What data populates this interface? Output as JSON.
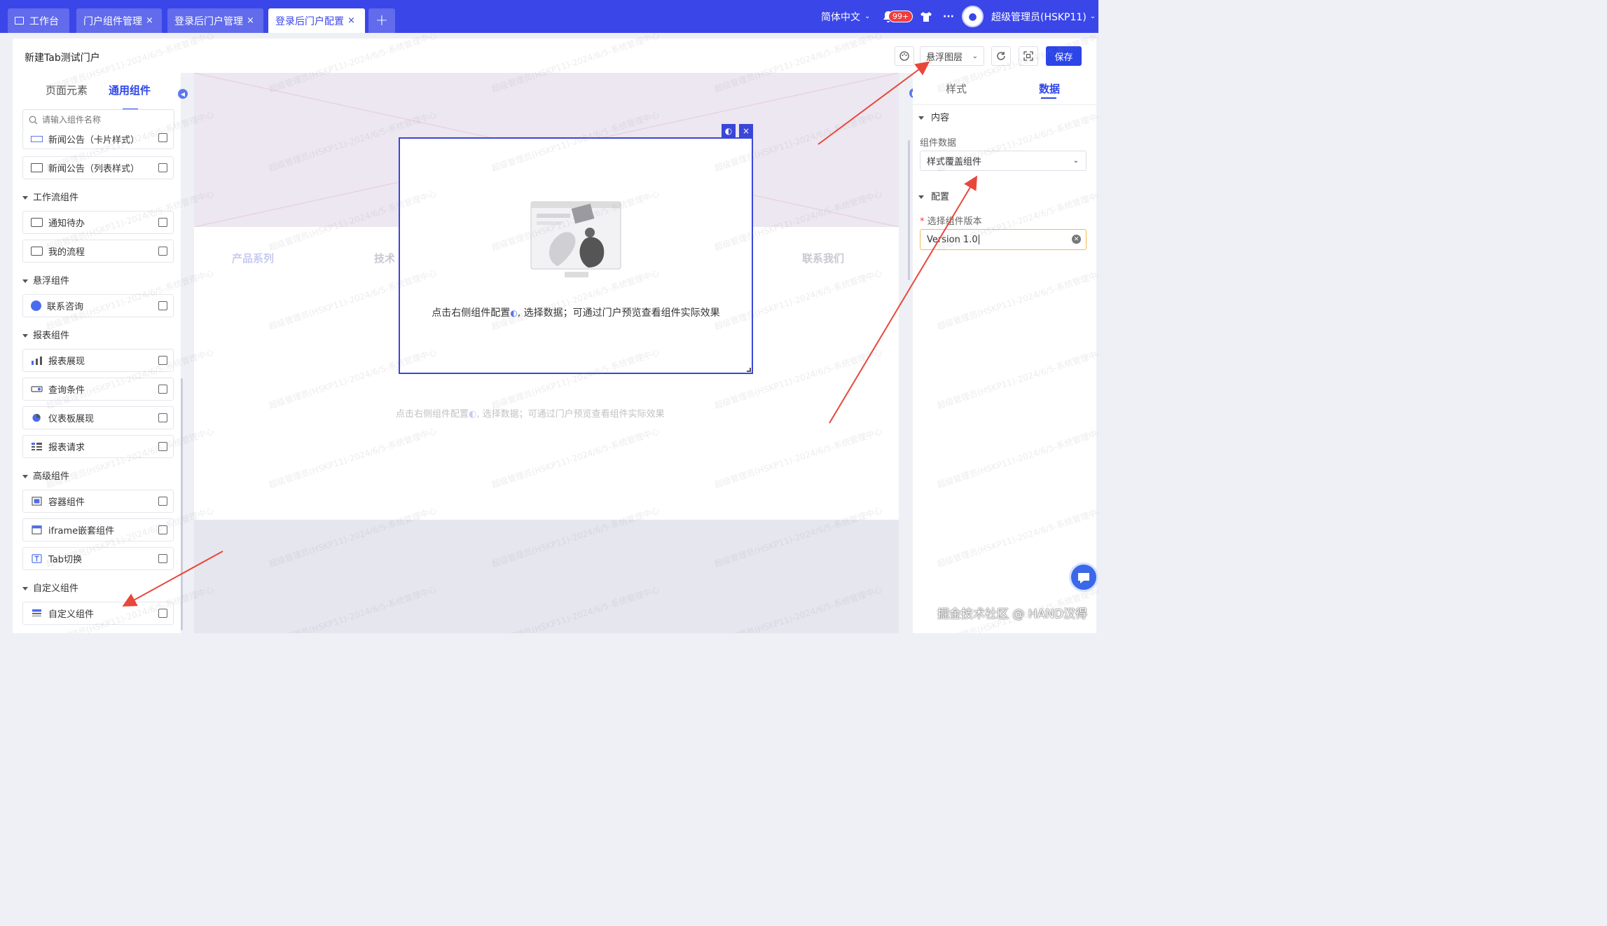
{
  "topbar": {
    "tabs": [
      {
        "label": "工作台",
        "closable": false,
        "active": false
      },
      {
        "label": "门户组件管理",
        "closable": true,
        "active": false
      },
      {
        "label": "登录后门户管理",
        "closable": true,
        "active": false
      },
      {
        "label": "登录后门户配置",
        "closable": true,
        "active": true
      }
    ],
    "add_tab": "+",
    "close_glyph": "×",
    "language": "简体中文",
    "notification_count": "99+",
    "more": "···",
    "user": "超级管理员(HSKP11)"
  },
  "editor": {
    "title": "新建Tab测试门户",
    "layer_select": "悬浮图层",
    "save_label": "保存"
  },
  "left_panel": {
    "tabs": [
      "页面元素",
      "通用组件"
    ],
    "active_tab": "通用组件",
    "search_placeholder": "请输入组件名称",
    "partial_item": "新闻公告（卡片样式）",
    "items_top": [
      {
        "label": "新闻公告（列表样式）",
        "icon": "list-icon"
      }
    ],
    "groups": [
      {
        "name": "工作流组件",
        "items": [
          {
            "label": "通知待办",
            "icon": "todo-icon"
          },
          {
            "label": "我的流程",
            "icon": "flow-icon"
          }
        ]
      },
      {
        "name": "悬浮组件",
        "items": [
          {
            "label": "联系咨询",
            "icon": "phone-icon"
          }
        ]
      },
      {
        "name": "报表组件",
        "items": [
          {
            "label": "报表展现",
            "icon": "bar-chart-icon"
          },
          {
            "label": "查询条件",
            "icon": "query-icon"
          },
          {
            "label": "仪表板展现",
            "icon": "pie-chart-icon"
          },
          {
            "label": "报表请求",
            "icon": "table-icon"
          }
        ]
      },
      {
        "name": "高级组件",
        "items": [
          {
            "label": "容器组件",
            "icon": "container-icon"
          },
          {
            "label": "iframe嵌套组件",
            "icon": "iframe-icon"
          },
          {
            "label": "Tab切换",
            "icon": "tab-icon"
          }
        ]
      },
      {
        "name": "自定义组件",
        "items": [
          {
            "label": "自定义组件",
            "icon": "custom-icon"
          }
        ]
      }
    ]
  },
  "canvas": {
    "nav": [
      "产品系列",
      "技术",
      "联系我们"
    ],
    "hint": "点击右侧组件配置",
    "hint_tail": ", 选择数据；可通过门户预览查看组件实际效果"
  },
  "popup": {
    "message": "点击右侧组件配置",
    "message_tail": ", 选择数据；可通过门户预览查看组件实际效果",
    "close": "×"
  },
  "right_panel": {
    "tabs": [
      "样式",
      "数据"
    ],
    "active_tab": "数据",
    "section_content": "内容",
    "component_data_label": "组件数据",
    "component_data_value": "样式覆盖组件",
    "section_config": "配置",
    "version_label": "选择组件版本",
    "version_value": "Version 1.0"
  },
  "watermark": "超级管理员(HSKP11)-2024/6/5-系统管理中心",
  "credit": "掘金技术社区 @ HAND汉得",
  "colors": {
    "primary": "#3a46e8",
    "accent_blue": "#2d45e8",
    "arrow": "#e8473a",
    "input_focus": "#f7b955"
  }
}
